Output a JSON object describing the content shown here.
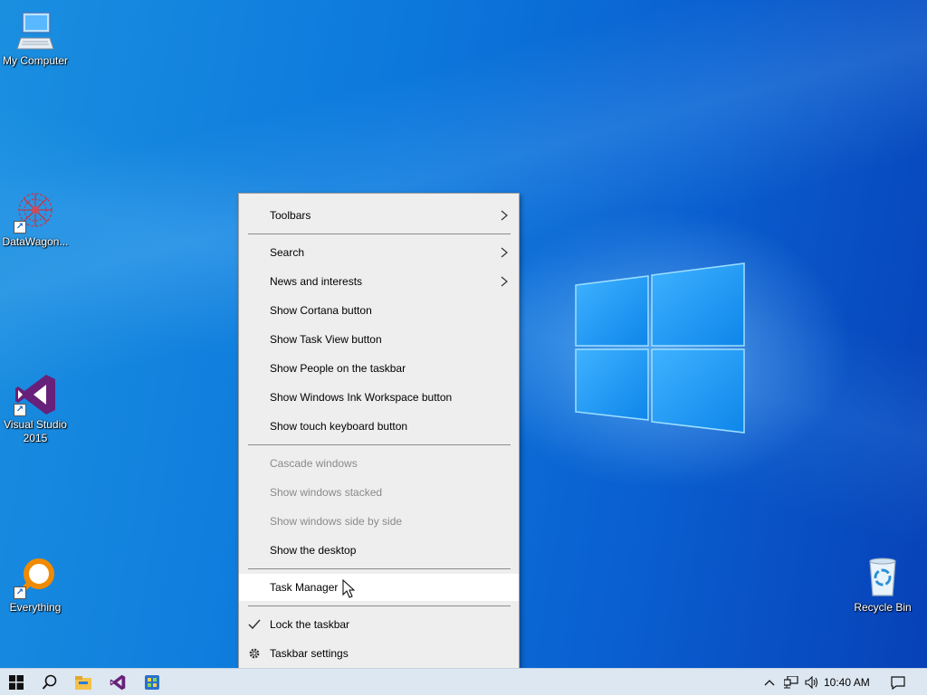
{
  "desktop": {
    "icons": [
      {
        "label": "My Computer"
      },
      {
        "label": "DataWagon..."
      },
      {
        "label": "Visual Studio 2015"
      },
      {
        "label": "Everything"
      },
      {
        "label": "Recycle Bin"
      }
    ]
  },
  "context_menu": {
    "items": {
      "toolbars": "Toolbars",
      "search": "Search",
      "news": "News and interests",
      "cortana": "Show Cortana button",
      "task_view": "Show Task View button",
      "people": "Show People on the taskbar",
      "ink": "Show Windows Ink Workspace button",
      "touch_keyboard": "Show touch keyboard button",
      "cascade": "Cascade windows",
      "stacked": "Show windows stacked",
      "side_by_side": "Show windows side by side",
      "show_desktop": "Show the desktop",
      "task_manager": "Task Manager",
      "lock_taskbar": "Lock the taskbar",
      "taskbar_settings": "Taskbar settings"
    },
    "states": {
      "lock_taskbar_checked": true,
      "hovered_item": "Task Manager",
      "disabled_items": [
        "Cascade windows",
        "Show windows stacked",
        "Show windows side by side"
      ]
    }
  },
  "taskbar": {
    "pinned": [
      "windows-start-icon",
      "search-icon",
      "file-explorer-icon",
      "visual-studio-icon",
      "app-icon"
    ],
    "tray_icons": [
      "chevron-up-icon",
      "network-icon",
      "volume-icon"
    ],
    "clock": "10:40 AM",
    "notification_icon": "action-center-icon"
  },
  "colors": {
    "desktop_blue": "#0c78dc",
    "menu_bg": "#eeeeee",
    "taskbar_bg": "#dde7f1",
    "vs_purple": "#68217a",
    "everything_orange": "#f08a00"
  }
}
